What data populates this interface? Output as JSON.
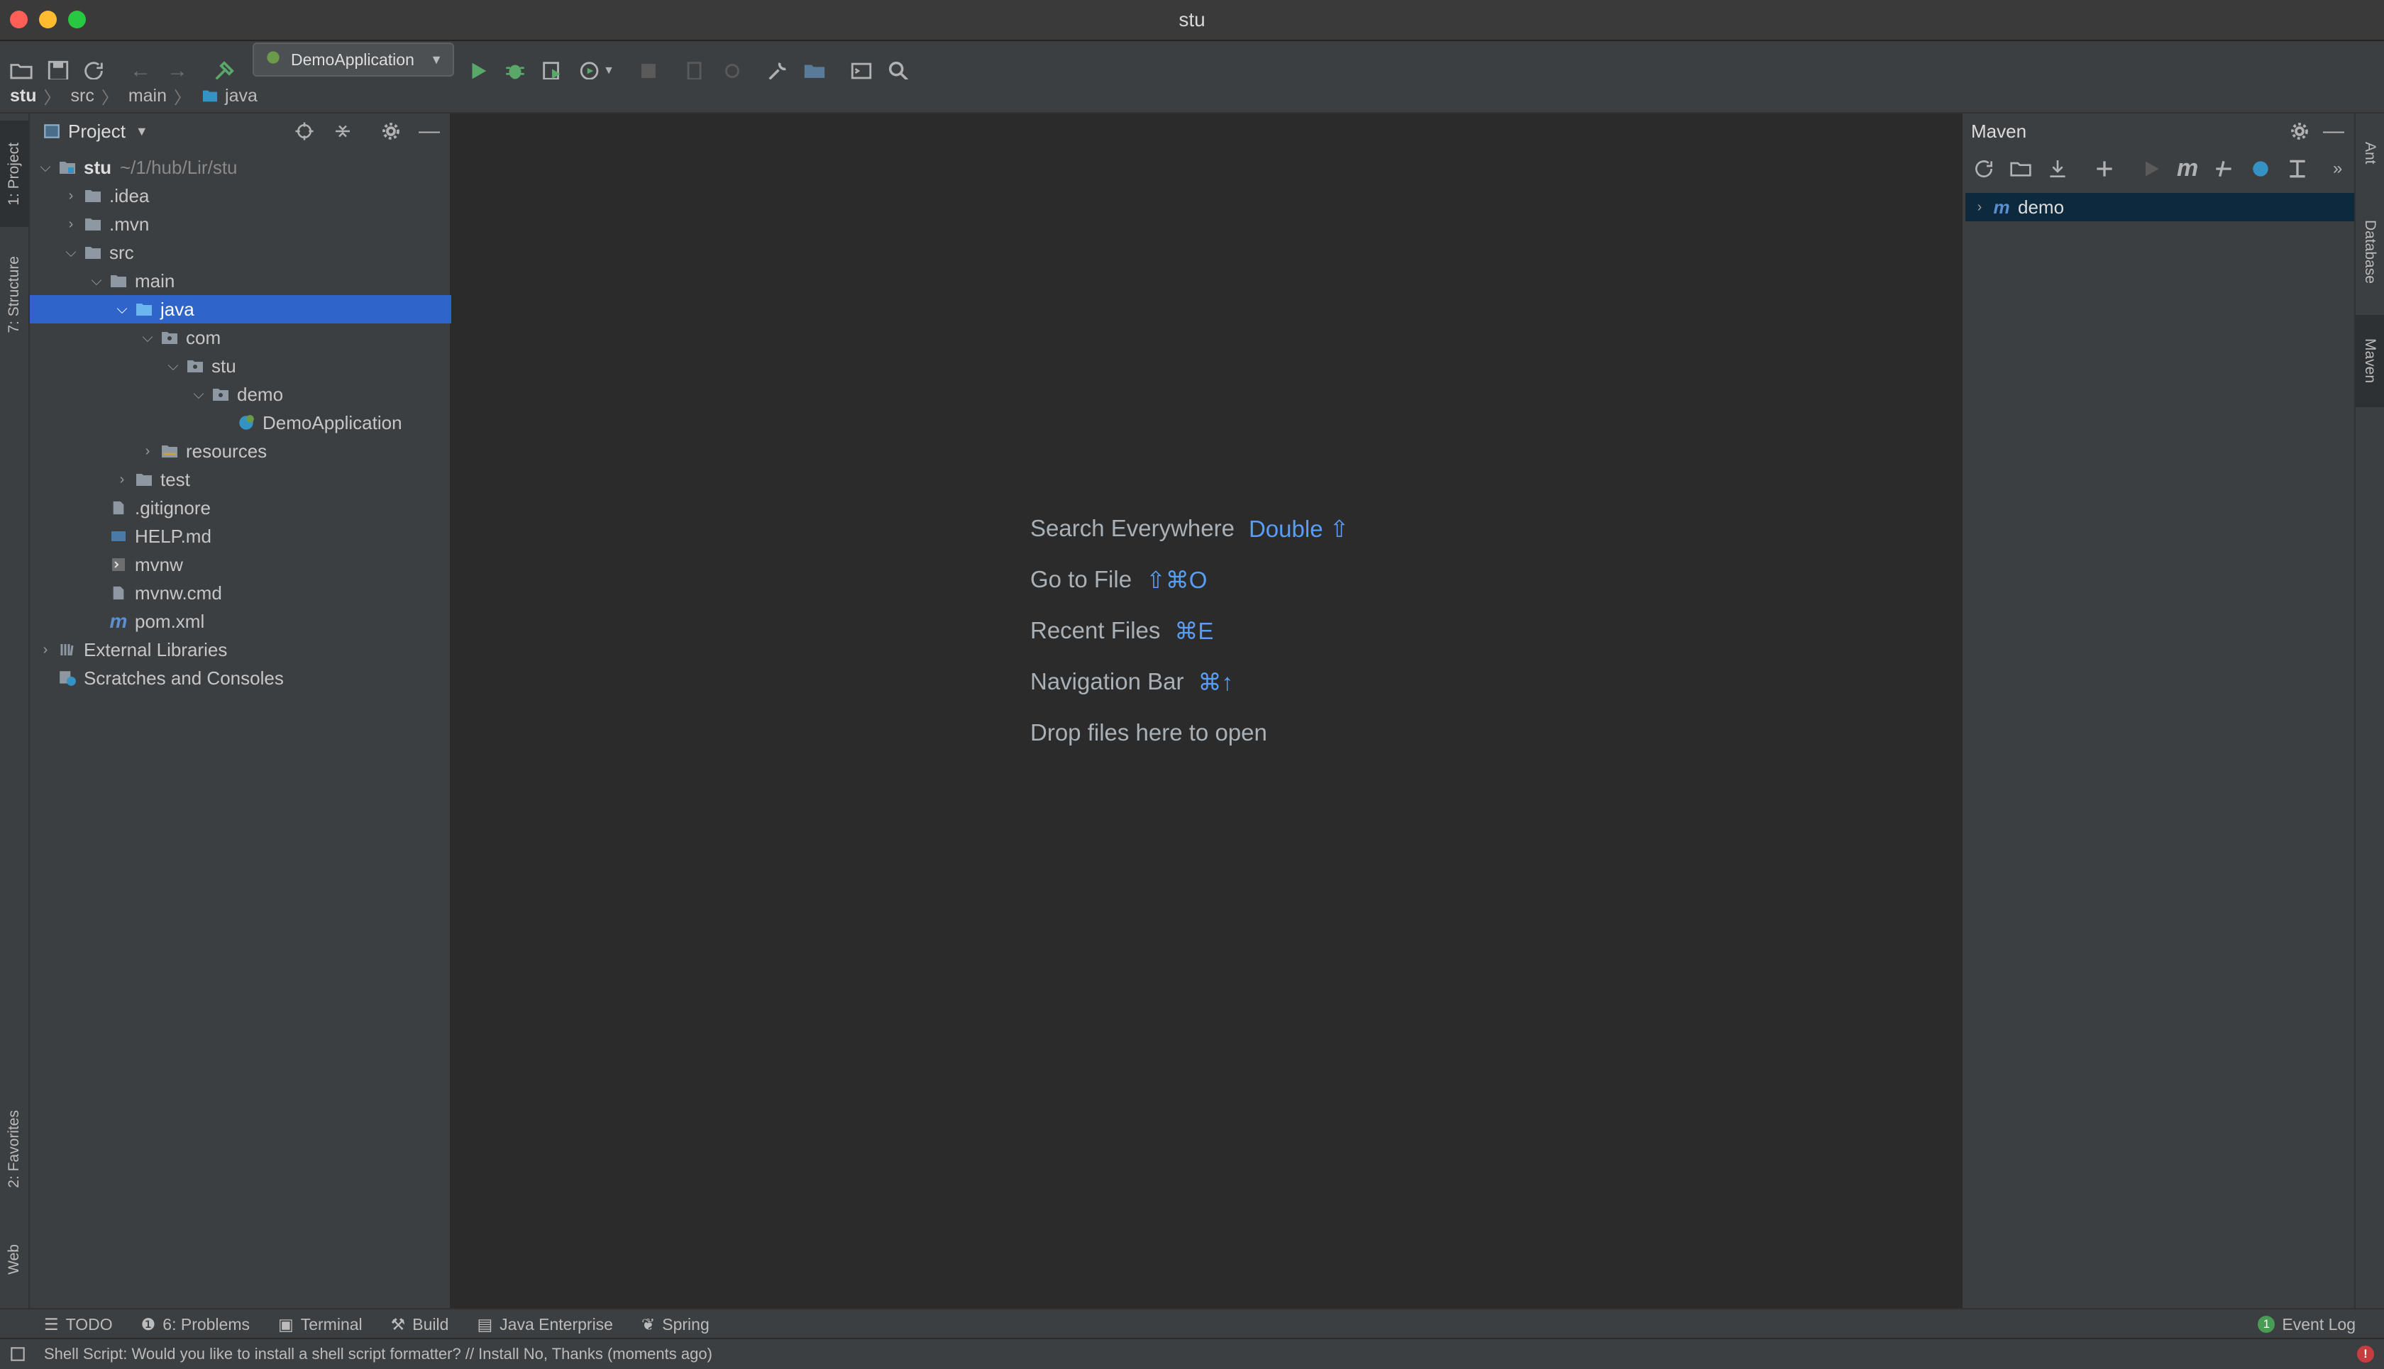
{
  "window": {
    "title": "stu"
  },
  "toolbar": {
    "run_config": "DemoApplication"
  },
  "breadcrumb": [
    {
      "label": "stu"
    },
    {
      "label": "src"
    },
    {
      "label": "main"
    },
    {
      "label": "java"
    }
  ],
  "left_stripe": {
    "project": "1: Project",
    "structure": "7: Structure",
    "favorites": "2: Favorites",
    "web": "Web"
  },
  "project": {
    "header": "Project",
    "tree": [
      {
        "label": "stu",
        "sub": "~/1/hub/Lir/stu",
        "icon": "module-folder-icon"
      },
      {
        "label": ".idea",
        "icon": "folder-icon"
      },
      {
        "label": ".mvn",
        "icon": "folder-icon"
      },
      {
        "label": "src",
        "icon": "folder-icon"
      },
      {
        "label": "main",
        "icon": "folder-icon"
      },
      {
        "label": "java",
        "icon": "source-folder-icon"
      },
      {
        "label": "com",
        "icon": "package-icon"
      },
      {
        "label": "stu",
        "icon": "package-icon"
      },
      {
        "label": "demo",
        "icon": "package-icon"
      },
      {
        "label": "DemoApplication",
        "icon": "spring-class-icon"
      },
      {
        "label": "resources",
        "icon": "resources-folder-icon"
      },
      {
        "label": "test",
        "icon": "folder-icon"
      },
      {
        "label": ".gitignore",
        "icon": "text-file-icon"
      },
      {
        "label": "HELP.md",
        "icon": "markdown-file-icon"
      },
      {
        "label": "mvnw",
        "icon": "shell-file-icon"
      },
      {
        "label": "mvnw.cmd",
        "icon": "text-file-icon"
      },
      {
        "label": "pom.xml",
        "icon": "maven-file-icon"
      },
      {
        "label": "External Libraries",
        "icon": "libraries-icon"
      },
      {
        "label": "Scratches and Consoles",
        "icon": "scratches-icon"
      }
    ]
  },
  "editor": {
    "hints": [
      {
        "label": "Search Everywhere",
        "key": "Double ⇧"
      },
      {
        "label": "Go to File",
        "key": "⇧⌘O"
      },
      {
        "label": "Recent Files",
        "key": "⌘E"
      },
      {
        "label": "Navigation Bar",
        "key": "⌘↑"
      },
      {
        "label": "Drop files here to open",
        "key": ""
      }
    ]
  },
  "maven": {
    "title": "Maven",
    "project": "demo"
  },
  "right_stripe": {
    "ant": "Ant",
    "database": "Database",
    "maven": "Maven"
  },
  "bottom_tabs": {
    "todo": "TODO",
    "problems": "6: Problems",
    "terminal": "Terminal",
    "build": "Build",
    "java_enterprise": "Java Enterprise",
    "spring": "Spring",
    "event_log": "Event Log",
    "event_count": "1"
  },
  "status": {
    "message": "Shell Script: Would you like to install a shell script formatter? // Install   No, Thanks (moments ago)"
  }
}
